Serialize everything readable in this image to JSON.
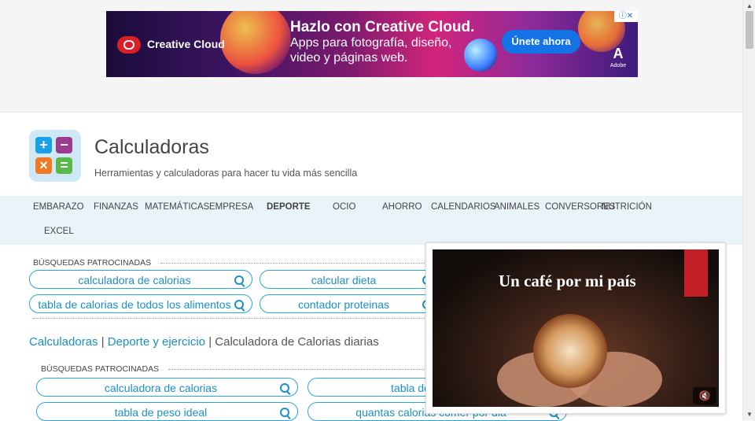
{
  "ad": {
    "brand": "Creative Cloud",
    "headline": "Hazlo con Creative Cloud.",
    "subline": "Apps para fotografía, diseño, video y páginas web.",
    "cta": "Únete ahora",
    "adobe_mark": "A",
    "adobe_text": "Adobe",
    "controls": "ⓘ✕"
  },
  "header": {
    "title": "Calculadoras",
    "subtitle": "Herramientas y calculadoras para hacer tu vida más sencilla",
    "logo_tiles": [
      "+",
      "−",
      "×",
      "="
    ]
  },
  "nav": {
    "items": [
      "EMBARAZO",
      "FINANZAS",
      "MATEMÁTICAS",
      "EMPRESA",
      "DEPORTE",
      "OCIO",
      "AHORRO",
      "CALENDARIOS",
      "ANIMALES",
      "CONVERSORES",
      "NUTRICIÓN",
      "EXCEL"
    ],
    "active": "DEPORTE"
  },
  "sponsored1": {
    "label": "BÚSQUEDAS PATROCINADAS",
    "items": [
      "calculadora de calorias",
      "calcular dieta",
      "tabla de calorias de todos los alimentos",
      "contador proteinas"
    ]
  },
  "breadcrumb": {
    "home": "Calculadoras",
    "sep": "|",
    "section": "Deporte y ejercicio",
    "current": "Calculadora de Calorias diarias"
  },
  "sponsored2": {
    "label": "BÚSQUEDAS PATROCINADAS",
    "items": [
      "calculadora de calorias",
      "tabla de calorias",
      "tabla de peso ideal",
      "quantas calorias comer por dia"
    ]
  },
  "video": {
    "title": "Un café por mi país",
    "mute_symbol": "🔇"
  },
  "colors": {
    "accent": "#1d8fc4",
    "nav_bg": "#e8f3fa",
    "cta": "#1473e6"
  }
}
